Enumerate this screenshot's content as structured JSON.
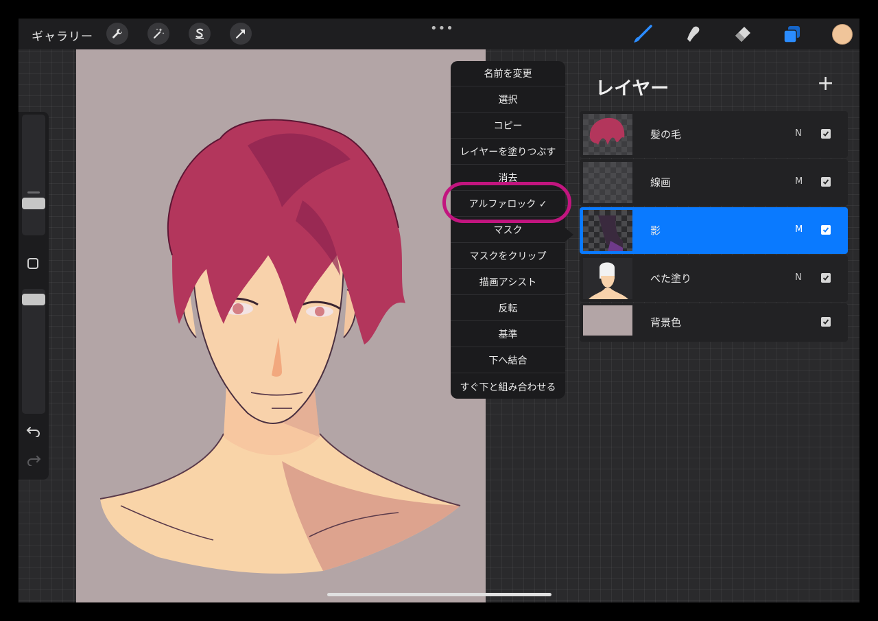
{
  "topbar": {
    "gallery_label": "ギャラリー",
    "more_label": "•••",
    "tools_left": [
      "wrench-icon",
      "magic-wand-icon",
      "selection-s-icon",
      "transform-arrow-icon"
    ],
    "tools_right": [
      "brush-icon",
      "smudge-icon",
      "eraser-icon",
      "layers-icon"
    ],
    "active_tool_color": "#2b8cff",
    "current_color": "#f0c59a"
  },
  "menu": {
    "items": [
      {
        "label": "名前を変更"
      },
      {
        "label": "選択"
      },
      {
        "label": "コピー"
      },
      {
        "label": "レイヤーを塗りつぶす"
      },
      {
        "label": "消去"
      },
      {
        "label": "アルファロック ✓"
      },
      {
        "label": "マスク"
      },
      {
        "label": "マスクをクリップ"
      },
      {
        "label": "描画アシスト"
      },
      {
        "label": "反転"
      },
      {
        "label": "基準"
      },
      {
        "label": "下へ結合"
      },
      {
        "label": "すぐ下と組み合わせる"
      }
    ],
    "highlight_color": "#c2157f"
  },
  "layers": {
    "title": "レイヤー",
    "add_label": "+",
    "rows": [
      {
        "name": "髪の毛",
        "mode": "N",
        "active": false
      },
      {
        "name": "線画",
        "mode": "M",
        "active": false
      },
      {
        "name": "影",
        "mode": "M",
        "active": true
      },
      {
        "name": "べた塗り",
        "mode": "N",
        "active": false
      },
      {
        "name": "背景色",
        "mode": "",
        "active": false
      }
    ]
  }
}
